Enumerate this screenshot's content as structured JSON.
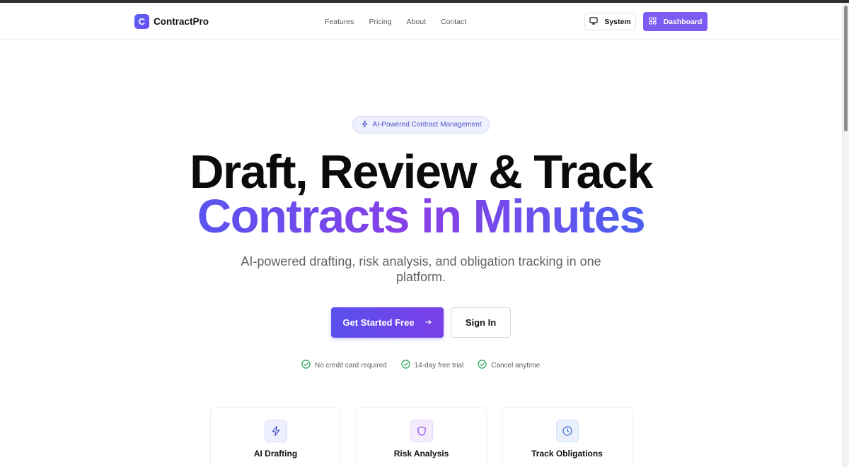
{
  "brand": {
    "logo_letter": "C",
    "name": "ContractPro"
  },
  "nav": [
    {
      "label": "Features"
    },
    {
      "label": "Pricing"
    },
    {
      "label": "About"
    },
    {
      "label": "Contact"
    }
  ],
  "header_actions": {
    "theme_label": "System",
    "theme_icon": "monitor-icon",
    "dashboard_label": "Dashboard",
    "dashboard_icon": "grid-icon"
  },
  "hero": {
    "badge": "AI-Powered Contract Management",
    "headline_line1": "Draft, Review & Track",
    "headline_line2": "Contracts in Minutes",
    "subtitle": "AI-powered drafting, risk analysis, and obligation tracking in one platform.",
    "primary_cta": "Get Started Free",
    "secondary_cta": "Sign In",
    "perks": [
      "No credit card required",
      "14-day free trial",
      "Cancel anytime"
    ]
  },
  "features": [
    {
      "title": "AI Drafting",
      "icon": "lightning-icon",
      "description": ""
    },
    {
      "title": "Risk Analysis",
      "icon": "shield-icon",
      "description": ""
    },
    {
      "title": "Track Obligations",
      "icon": "clock-icon",
      "description": ""
    }
  ],
  "colors": {
    "accent": "#7c5cf3",
    "gradient_start": "#5a54f0",
    "gradient_mid": "#8a3fe8",
    "gradient_end": "#4c60f0",
    "check_green": "#22a55b"
  }
}
